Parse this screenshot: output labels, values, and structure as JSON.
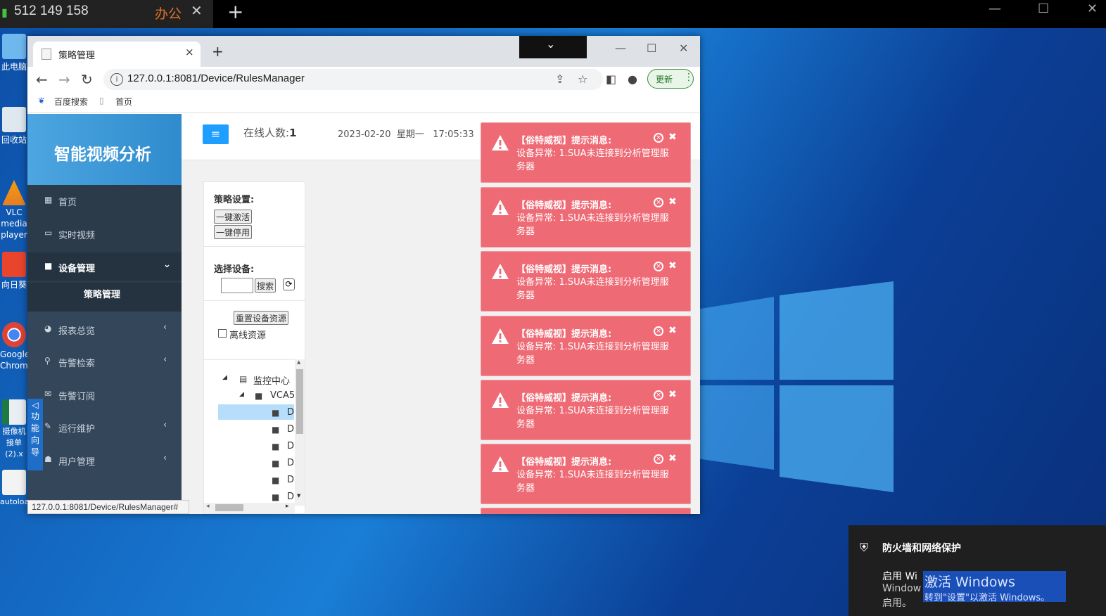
{
  "remote": {
    "connection_id": "512 149 158",
    "session_name": "办公",
    "close": "✕",
    "add": "+",
    "minimize": "—",
    "maximize": "☐",
    "window_close": "✕"
  },
  "desktop_icons": [
    {
      "label": "此电脑"
    },
    {
      "label": "回收站"
    },
    {
      "label": "VLC media player"
    },
    {
      "label": "向日葵"
    },
    {
      "label": "Google Chrome"
    },
    {
      "label": "摄像机接单(2).x"
    },
    {
      "label": "autoload"
    }
  ],
  "browser": {
    "tab_title": "策略管理",
    "tab_close": "×",
    "new_tab": "+",
    "overlay_chevron": "⌄",
    "minimize": "—",
    "maximize": "☐",
    "close": "✕",
    "back": "←",
    "forward": "→",
    "reload": "↻",
    "url": "127.0.0.1:8081/Device/RulesManager",
    "update_label": "更新",
    "update_menu": "⋮",
    "bookmarks": [
      {
        "label": "百度搜索"
      },
      {
        "label": "首页"
      }
    ],
    "status_url": "127.0.0.1:8081/Device/RulesManager#"
  },
  "app": {
    "brand": "智能视频分析",
    "menu": [
      {
        "label": "首页",
        "icon": "grid-icon",
        "glyph": "▦"
      },
      {
        "label": "实时视频",
        "icon": "monitor-icon",
        "glyph": "▭"
      },
      {
        "label": "设备管理",
        "icon": "camera-icon",
        "glyph": "■",
        "arrow": "⌄"
      },
      {
        "label": "报表总览",
        "icon": "pie-icon",
        "glyph": "◕",
        "arrow": "‹"
      },
      {
        "label": "告警检索",
        "icon": "search-icon",
        "glyph": "⚲",
        "arrow": "‹"
      },
      {
        "label": "告警订阅",
        "icon": "mail-icon",
        "glyph": "✉"
      },
      {
        "label": "运行维护",
        "icon": "wrench-icon",
        "glyph": "✎",
        "arrow": "‹"
      },
      {
        "label": "用户管理",
        "icon": "users-icon",
        "glyph": "☗",
        "arrow": "‹"
      }
    ],
    "submenu_active": "策略管理",
    "toggle_glyph": "≡",
    "online_label": "在线人数:",
    "online_count": "1",
    "date": "2023-02-20",
    "weekday": "星期一",
    "time": "17:05:33",
    "panel": {
      "strategy_label": "策略设置:",
      "activate_all": "一键激活",
      "deactivate_all": "一键停用",
      "select_device_label": "选择设备:",
      "search_value": "",
      "search_button": "搜索",
      "refresh_glyph": "⟳",
      "reset_button": "重置设备资源",
      "offline_label": "离线资源",
      "offline_checked": false,
      "tree": [
        {
          "label": "监控中心",
          "toggle": "◢",
          "icon": "▤"
        },
        {
          "label": "VCA5",
          "toggle": "◢",
          "icon": "■"
        },
        {
          "label": "D",
          "icon": "■"
        },
        {
          "label": "D",
          "icon": "■"
        },
        {
          "label": "D",
          "icon": "■"
        },
        {
          "label": "D",
          "icon": "■"
        },
        {
          "label": "D",
          "icon": "■"
        },
        {
          "label": "D",
          "icon": "■"
        }
      ],
      "scroll_up": "▲",
      "scroll_down": "▼",
      "scroll_left": "◂",
      "scroll_right": "▸"
    },
    "guide": [
      "◁",
      "功",
      "能",
      "向",
      "导"
    ]
  },
  "notifications": [
    {
      "title": "【俗特威视】提示消息:",
      "body": "设备异常: 1.SUA未连接到分析管理服务器"
    },
    {
      "title": "【俗特威视】提示消息:",
      "body": "设备异常: 1.SUA未连接到分析管理服务器"
    },
    {
      "title": "【俗特威视】提示消息:",
      "body": "设备异常: 1.SUA未连接到分析管理服务器"
    },
    {
      "title": "【俗特威视】提示消息:",
      "body": "设备异常: 1.SUA未连接到分析管理服务器"
    },
    {
      "title": "【俗特威视】提示消息:",
      "body": "设备异常: 1.SUA未连接到分析管理服务器"
    },
    {
      "title": "【俗特威视】提示消息:",
      "body": "设备异常: 1.SUA未连接到分析管理服务器"
    }
  ],
  "notification_close": "✖",
  "notification_dismiss": "×",
  "security": {
    "icon": "⛨",
    "title": "防火墙和网络保护",
    "line1": "启用 Wi",
    "line2": "Window",
    "line3": "启用。"
  },
  "activation": {
    "line1": "激活 Windows",
    "line2": "转到\"设置\"以激活 Windows。"
  },
  "colors": {
    "accent": "#1e9fff",
    "sidebar": "#2c3b4a",
    "toast": "#ee6a74"
  }
}
